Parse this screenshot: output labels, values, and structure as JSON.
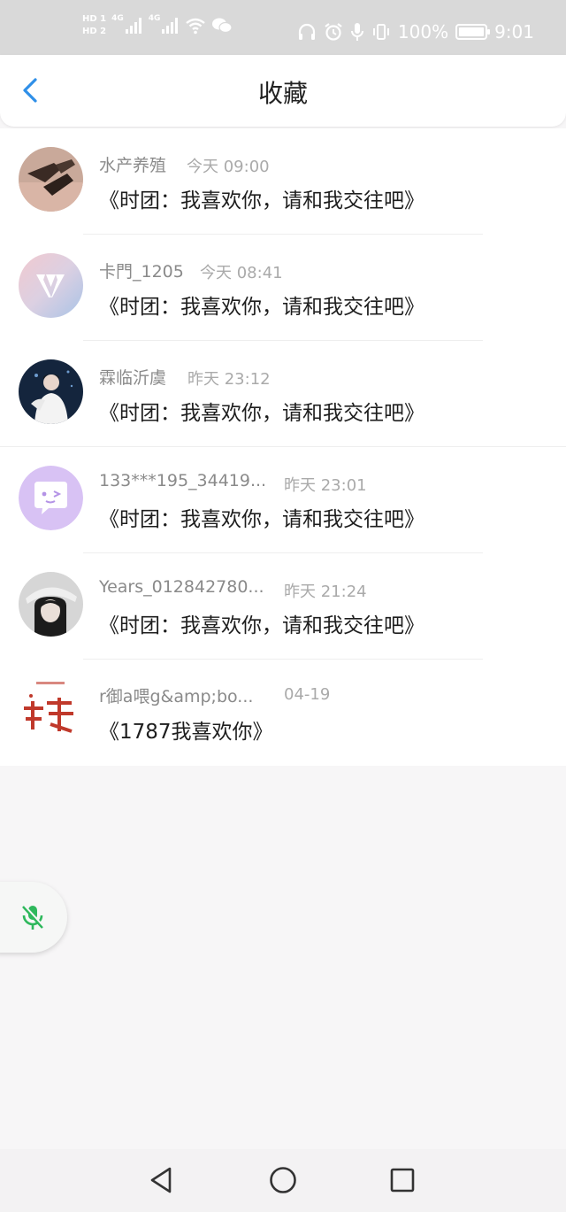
{
  "status_bar": {
    "hd1": "HD 1",
    "hd2": "HD 2",
    "net1": "4G",
    "net2": "4G",
    "battery": "100%",
    "time": "9:01"
  },
  "header": {
    "title": "收藏"
  },
  "favorites": [
    {
      "name": "水产养殖",
      "time": "今天 09:00",
      "message": "《时团：我喜欢你，请和我交往吧》"
    },
    {
      "name": "卡門_1205",
      "time": "今天 08:41",
      "message": "《时团：我喜欢你，请和我交往吧》"
    },
    {
      "name": "霖临沂虞",
      "time": "昨天 23:12",
      "message": "《时团：我喜欢你，请和我交往吧》"
    },
    {
      "name": "133***195_34419...",
      "time": "昨天 23:01",
      "message": "《时团：我喜欢你，请和我交往吧》"
    },
    {
      "name": "Years_012842780...",
      "time": "昨天 21:24",
      "message": "《时团：我喜欢你，请和我交往吧》"
    },
    {
      "name": "r御a喂g&amp;bo...",
      "time": "04-19",
      "message": "《1787我喜欢你》"
    }
  ],
  "colors": {
    "accent": "#2f8fe8",
    "mic_green": "#2eb85c",
    "background": "#f7f6f7"
  }
}
